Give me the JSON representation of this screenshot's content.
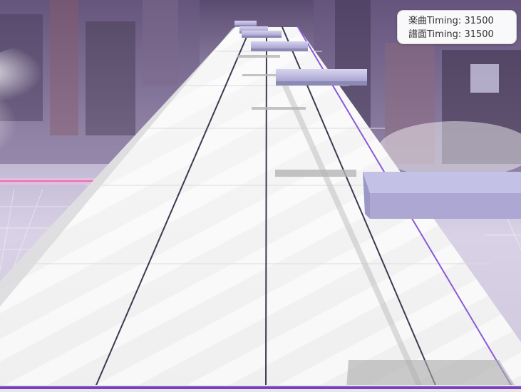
{
  "hud": {
    "music_timing_label": "楽曲Timing:",
    "music_timing_value": "31500",
    "chart_timing_label": "譜面Timing:",
    "chart_timing_value": "31500"
  },
  "colors": {
    "lane_surface": "#f1f1f1",
    "note": "#b8b5dc",
    "judge_line": "#7a3fc1",
    "accent_pink": "#e05aa0",
    "background_dark": "#3a3050"
  },
  "lanes": {
    "count": 4
  }
}
